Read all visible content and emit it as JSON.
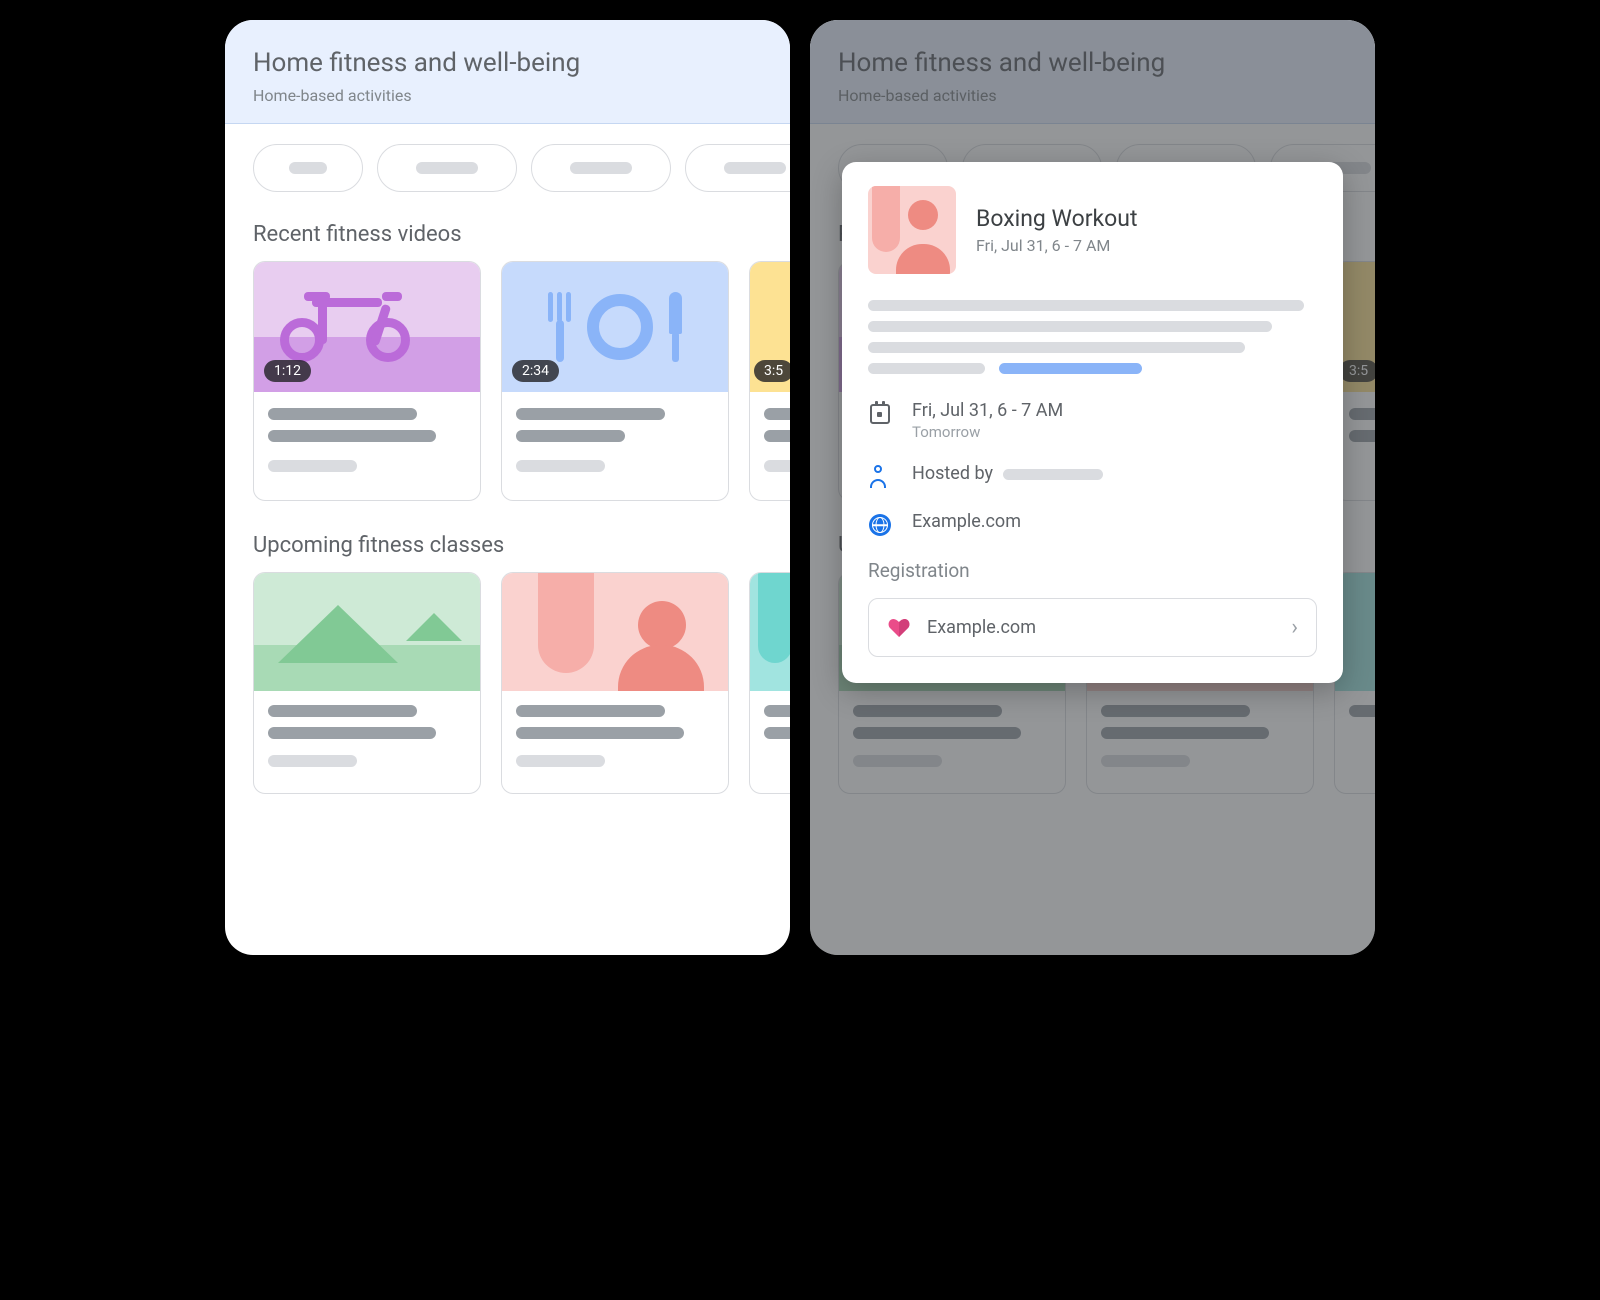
{
  "header": {
    "title": "Home fitness and well-being",
    "subtitle": "Home-based activities"
  },
  "sections": {
    "videos_title": "Recent fitness videos",
    "classes_title": "Upcoming fitness classes"
  },
  "videos": [
    {
      "duration": "1:12"
    },
    {
      "duration": "2:34"
    },
    {
      "duration": "3:5"
    }
  ],
  "detail": {
    "title": "Boxing Workout",
    "subtitle": "Fri, Jul 31, 6 - 7 AM",
    "datetime": "Fri, Jul 31, 6 - 7 AM",
    "relative": "Tomorrow",
    "hosted_by_label": "Hosted by",
    "website": "Example.com",
    "registration_label": "Registration",
    "registration_site": "Example.com"
  }
}
